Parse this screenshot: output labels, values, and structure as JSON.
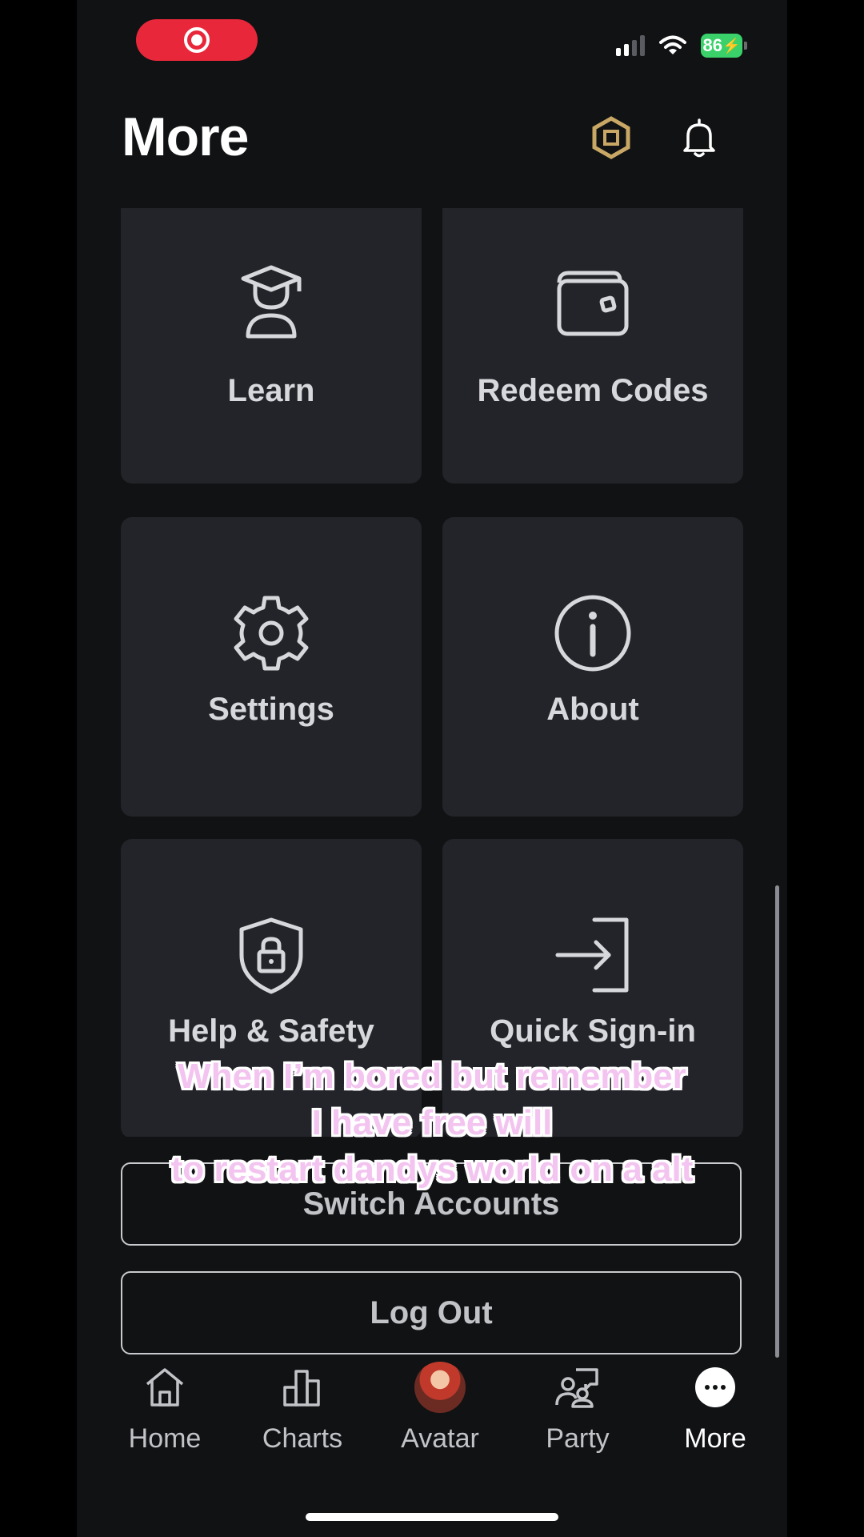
{
  "header": {
    "title": "More"
  },
  "status_bar": {
    "battery": "86"
  },
  "tiles": [
    {
      "label": "Learn",
      "icon": "learn-icon"
    },
    {
      "label": "Redeem Codes",
      "icon": "wallet-icon"
    },
    {
      "label": "Settings",
      "icon": "gear-icon"
    },
    {
      "label": "About",
      "icon": "info-icon"
    },
    {
      "label": "Help & Safety",
      "icon": "shield-lock-icon"
    },
    {
      "label": "Quick Sign-in",
      "icon": "sign-in-icon"
    }
  ],
  "buttons": {
    "switch_accounts": "Switch Accounts",
    "log_out": "Log Out"
  },
  "caption": {
    "line1": "When I’m bored but remember",
    "line2": "I have free will",
    "line3": "to restart dandys world on a alt"
  },
  "nav": [
    {
      "label": "Home",
      "icon": "home-icon"
    },
    {
      "label": "Charts",
      "icon": "charts-icon"
    },
    {
      "label": "Avatar",
      "icon": "avatar-icon"
    },
    {
      "label": "Party",
      "icon": "party-icon"
    },
    {
      "label": "More",
      "icon": "more-icon",
      "active": true
    }
  ],
  "colors": {
    "background": "#111214",
    "tile": "#232429",
    "record": "#e8283a",
    "battery": "#3ad16a",
    "robux": "#c9a865"
  }
}
